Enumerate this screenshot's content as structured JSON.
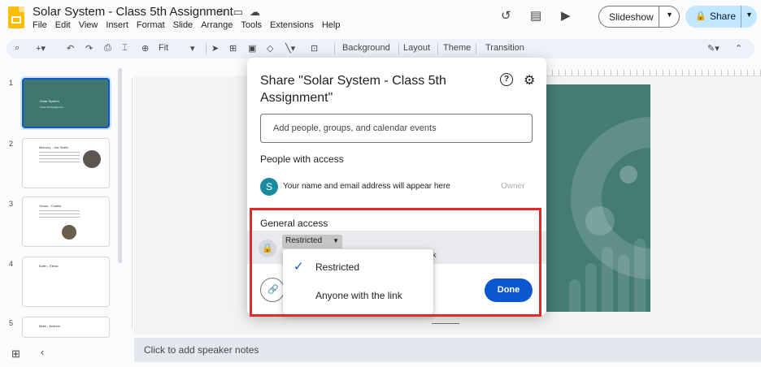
{
  "app": {
    "doc_title": "Solar System - Class  5th Assignment",
    "menu": [
      "File",
      "Edit",
      "View",
      "Insert",
      "Format",
      "Slide",
      "Arrange",
      "Tools",
      "Extensions",
      "Help"
    ],
    "slideshow_label": "Slideshow",
    "share_label": "Share"
  },
  "toolbar": {
    "zoom_value": "Fit",
    "background_label": "Background",
    "layout_label": "Layout",
    "theme_label": "Theme",
    "transition_label": "Transition"
  },
  "filmstrip": {
    "slides": [
      {
        "num": "1",
        "title": "Solar System",
        "subtitle": "Class 5th Assignment"
      },
      {
        "num": "2",
        "title": "Mercury - Joe Smith"
      },
      {
        "num": "3",
        "title": "Venus - Charlie"
      },
      {
        "num": "4",
        "title": "Earth - Elena"
      },
      {
        "num": "5",
        "title": "Mars - Andrew"
      }
    ]
  },
  "notes": {
    "placeholder": "Click to add speaker notes"
  },
  "share_dialog": {
    "title": "Share \"Solar System - Class 5th Assignment\"",
    "add_people_placeholder": "Add people, groups, and calendar events",
    "people_heading": "People with access",
    "person": {
      "avatar_letter": "S",
      "text": "Your name and email address will appear here",
      "role": "Owner"
    },
    "general_access_heading": "General access",
    "access_value": "Restricted",
    "access_desc_tail": "k",
    "done_label": "Done",
    "dropdown": {
      "options": [
        "Restricted",
        "Anyone with the link"
      ],
      "selected": "Restricted"
    }
  },
  "colors": {
    "accent": "#0b57d0",
    "share_button": "#c2e7ff",
    "slide_bg": "#457b75",
    "highlight": "#e22a2a",
    "avatar": "#1a8a9e"
  }
}
